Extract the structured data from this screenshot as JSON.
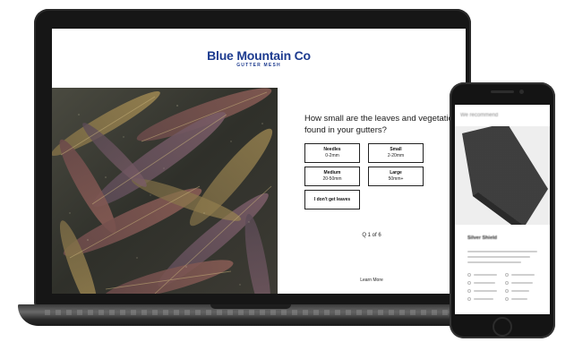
{
  "brand": {
    "name": "Blue Mountain Co",
    "tagline": "GUTTER MESH",
    "color": "#1d3b8f"
  },
  "quiz": {
    "question": "How small are the leaves and vegetation found in your gutters?",
    "options": [
      {
        "name": "Needles",
        "range": "0-2mm"
      },
      {
        "name": "Small",
        "range": "2-20mm"
      },
      {
        "name": "Medium",
        "range": "20-50mm"
      },
      {
        "name": "Large",
        "range": "50mm+"
      },
      {
        "name": "I don't get leaves",
        "range": ""
      }
    ],
    "progress": "Q 1 of 6",
    "learn_more": "Learn More"
  },
  "phone": {
    "title": "We recommend",
    "product_name": "Silver Shield"
  }
}
